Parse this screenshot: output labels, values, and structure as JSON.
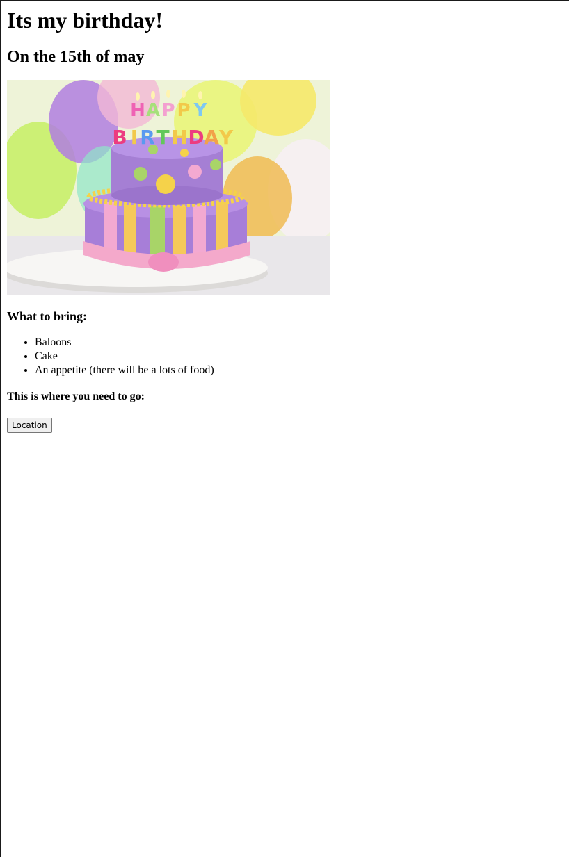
{
  "page": {
    "title": "Its my birthday!",
    "subtitle": "On the 15th of may"
  },
  "image": {
    "subject": "birthday-cake",
    "candle_letters": "HAPPY BIRTHDAY"
  },
  "bring_section": {
    "heading": "What to bring:",
    "items": [
      "Baloons",
      "Cake",
      "An appetite (there will be a lots of food)"
    ]
  },
  "location_section": {
    "heading": "This is where you need to go:",
    "button_label": "Location"
  }
}
